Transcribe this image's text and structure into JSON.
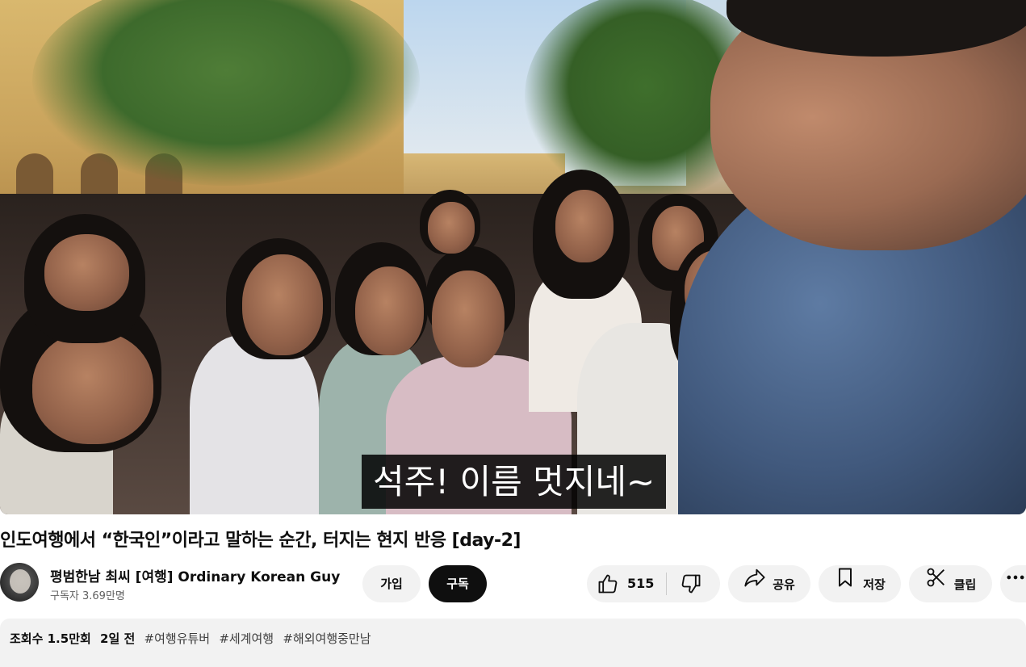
{
  "video": {
    "subtitle": "석주! 이름 멋지네~"
  },
  "title": "인도여행에서 “한국인”이라고 말하는 순간, 터지는 현지 반응 [day-2]",
  "channel": {
    "name": "평범한남 최씨 [여행] Ordinary Korean Guy",
    "subscribers": "구독자 3.69만명"
  },
  "actions": {
    "join_label": "가입",
    "subscribe_label": "구독",
    "like_count": "515",
    "share_label": "공유",
    "save_label": "저장",
    "clip_label": "클립",
    "more_label": "···"
  },
  "description": {
    "views": "조회수 1.5만회",
    "date": "2일 전",
    "hashtags": [
      "#여행유튜버",
      "#세계여행",
      "#해외여행중만남"
    ]
  },
  "icons": {
    "like": "thumbs-up-icon",
    "dislike": "thumbs-down-icon",
    "share": "share-arrow-icon",
    "save": "bookmark-icon",
    "clip": "scissors-icon",
    "more": "more-dots-icon"
  },
  "colors": {
    "subscribe_bg": "#0f0f0f",
    "pill_bg": "#f2f2f2",
    "subtitle_bg": "#000000"
  }
}
